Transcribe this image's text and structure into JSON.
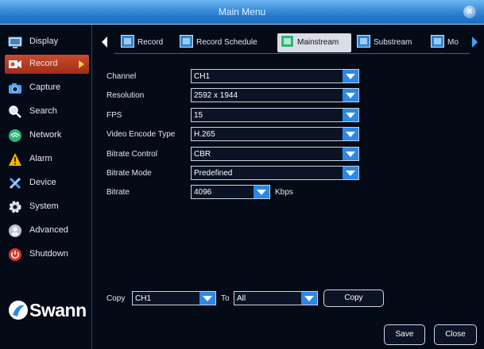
{
  "window": {
    "title": "Main Menu",
    "close_icon": "close-icon"
  },
  "sidebar": {
    "items": [
      {
        "label": "Display",
        "icon": "display-icon",
        "active": false
      },
      {
        "label": "Record",
        "icon": "record-icon",
        "active": true
      },
      {
        "label": "Capture",
        "icon": "capture-icon",
        "active": false
      },
      {
        "label": "Search",
        "icon": "search-icon",
        "active": false
      },
      {
        "label": "Network",
        "icon": "network-icon",
        "active": false
      },
      {
        "label": "Alarm",
        "icon": "alarm-icon",
        "active": false
      },
      {
        "label": "Device",
        "icon": "device-icon",
        "active": false
      },
      {
        "label": "System",
        "icon": "system-icon",
        "active": false
      },
      {
        "label": "Advanced",
        "icon": "advanced-icon",
        "active": false
      },
      {
        "label": "Shutdown",
        "icon": "shutdown-icon",
        "active": false
      }
    ],
    "logo": "Swann"
  },
  "tabs": [
    {
      "label": "Record",
      "active": false
    },
    {
      "label": "Record Schedule",
      "active": false
    },
    {
      "label": "Mainstream",
      "active": true
    },
    {
      "label": "Substream",
      "active": false
    },
    {
      "label": "Mo",
      "active": false
    }
  ],
  "fields": [
    {
      "label": "Channel",
      "value": "CH1"
    },
    {
      "label": "Resolution",
      "value": "2592 x 1944"
    },
    {
      "label": "FPS",
      "value": "15"
    },
    {
      "label": "Video Encode Type",
      "value": "H.265"
    },
    {
      "label": "Bitrate Control",
      "value": "CBR"
    },
    {
      "label": "Bitrate Mode",
      "value": "Predefined"
    },
    {
      "label": "Bitrate",
      "value": "4096",
      "unit": "Kbps"
    }
  ],
  "copy": {
    "label": "Copy",
    "from_value": "CH1",
    "to_label": "To",
    "to_value": "All",
    "button_label": "Copy"
  },
  "footer": {
    "save_label": "Save",
    "close_label": "Close"
  },
  "colors": {
    "accent_blue": "#2b88e6",
    "active_red": "#c84b2e",
    "arrow_yellow": "#ffd24a"
  }
}
